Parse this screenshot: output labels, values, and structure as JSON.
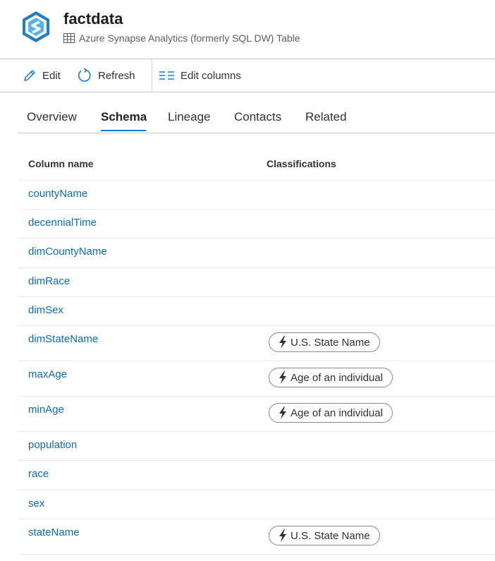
{
  "asset": {
    "title": "factdata",
    "subtitle": "Azure Synapse Analytics (formerly SQL DW) Table"
  },
  "toolbar": {
    "edit_label": "Edit",
    "refresh_label": "Refresh",
    "edit_columns_label": "Edit columns"
  },
  "tabs": [
    {
      "label": "Overview"
    },
    {
      "label": "Schema",
      "active": true
    },
    {
      "label": "Lineage"
    },
    {
      "label": "Contacts"
    },
    {
      "label": "Related"
    }
  ],
  "schema": {
    "headers": {
      "column_name": "Column name",
      "classifications": "Classifications"
    },
    "rows": [
      {
        "name": "countyName",
        "classification": ""
      },
      {
        "name": "decennialTime",
        "classification": ""
      },
      {
        "name": "dimCountyName",
        "classification": ""
      },
      {
        "name": "dimRace",
        "classification": ""
      },
      {
        "name": "dimSex",
        "classification": ""
      },
      {
        "name": "dimStateName",
        "classification": "U.S. State Name"
      },
      {
        "name": "maxAge",
        "classification": "Age of an individual"
      },
      {
        "name": "minAge",
        "classification": "Age of an individual"
      },
      {
        "name": "population",
        "classification": ""
      },
      {
        "name": "race",
        "classification": ""
      },
      {
        "name": "sex",
        "classification": ""
      },
      {
        "name": "stateName",
        "classification": "U.S. State Name"
      }
    ]
  },
  "icons": {
    "logo": "synapse-logo-icon",
    "table": "table-icon",
    "edit": "pencil-icon",
    "refresh": "refresh-icon",
    "edit_columns": "columns-icon",
    "classification": "lightning-icon"
  },
  "colors": {
    "accent": "#0078d4",
    "link": "#0b6cbd",
    "logo": "#1e7fc8"
  }
}
